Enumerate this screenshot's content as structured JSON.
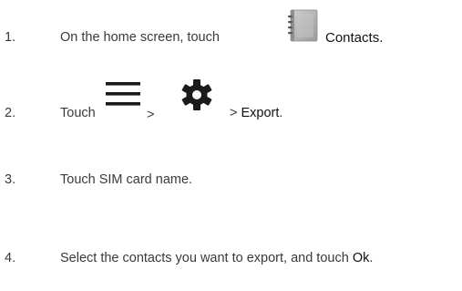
{
  "steps": [
    {
      "number": "1.",
      "text_before": "On the home screen, touch",
      "icon": "contacts-app-icon",
      "target": "Contacts."
    },
    {
      "number": "2.",
      "text_before": "Touch",
      "icon_1": "hamburger-menu-icon",
      "separator_1": ">",
      "icon_2": "gear-icon",
      "separator_2": "> ",
      "target": "Export",
      "punct": "."
    },
    {
      "number": "3.",
      "text": "Touch SIM card name."
    },
    {
      "number": "4.",
      "text_before": "Select the contacts you want to export, and touch ",
      "target": "Ok",
      "punct": "."
    }
  ],
  "colors": {
    "text": "#3a3a3a",
    "emphasis": "#111111",
    "icon": "#1a1a1a"
  }
}
